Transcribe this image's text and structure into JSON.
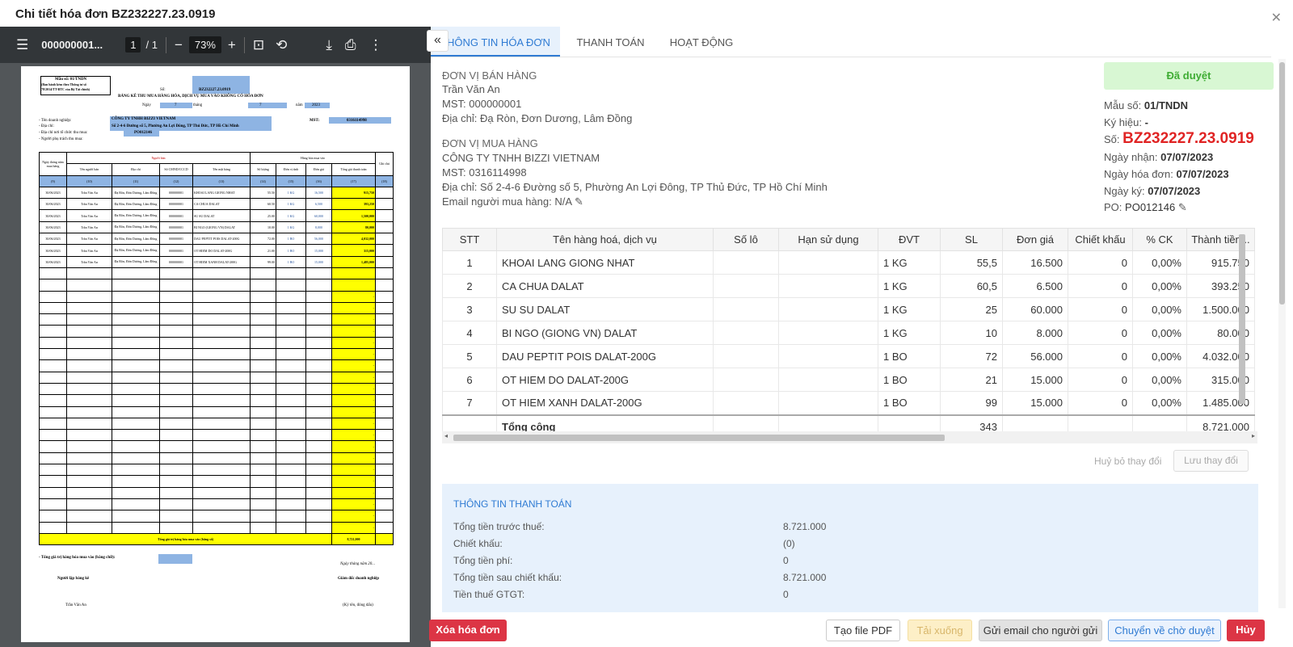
{
  "modal": {
    "title": "Chi tiết hóa đơn BZ232227.23.0919"
  },
  "pdf": {
    "filename": "000000001...",
    "page_current": "1",
    "page_total": "/ 1",
    "zoom": "73%",
    "sheet": {
      "mau_so": "Mẫu số: 01/TNDN",
      "note1": "(Ban hành kèm theo Thông tư số",
      "note2": "78/2014/TT-BTC của Bộ Tài chính)",
      "so_label": "Số:",
      "so": "BZ232227.23.0919",
      "title": "BẢNG KÊ THU MUA HÀNG HÓA, DỊCH VỤ MUA VÀO KHÔNG CÓ HÓA ĐƠN",
      "ngay_label": "Ngày",
      "ngay": "7",
      "thang_label": "tháng",
      "thang": "7",
      "nam_label": "năm",
      "nam": "2023",
      "dn_label": "- Tên doanh nghiệp:",
      "dn": "CÔNG TY TNHH BIZZI VIETNAM",
      "mst_label": "MST:",
      "mst": "0316114998",
      "dc_label": "- Địa chỉ:",
      "dc": "Số 2-4-6 Đường số 5, Phường An Lợi Đông, TP Thủ Đức, TP Hồ Chí Minh",
      "noi_label": "- Địa chỉ nơi tổ chức thu mua:",
      "po": "PO012146",
      "nguoi_label": "- Người phụ trách thu mua:",
      "h_nguoiban": "Người bán",
      "h_hanghoa": "Hàng hóa mua vào",
      "cols": [
        "Ngày tháng năm mua hàng",
        "Tên người bán",
        "Địa chỉ",
        "Số CMND/CCCD",
        "Tên mặt hàng",
        "Số lượng",
        "Đơn vị tính",
        "Đơn giá",
        "Tổng giá thanh toán",
        "Ghi chú"
      ],
      "colnums": [
        "(9)",
        "(10)",
        "(11)",
        "(12)",
        "(13)",
        "(14)",
        "(15)",
        "(16)",
        "(17)",
        "(18)"
      ],
      "rows": [
        [
          "30/06/2023",
          "Trần Văn An",
          "Đạ Rồn, Đơn Dương, Lâm Đồng",
          "000000001",
          "KHOAI LANG GIONG NHAT",
          "55.50",
          "1 KG",
          "16,500",
          "915,750"
        ],
        [
          "30/06/2023",
          "Trần Văn An",
          "Đạ Rồn, Đơn Dương, Lâm Đồng",
          "000000001",
          "CA CHUA DALAT",
          "60.50",
          "1 KG",
          "6,500",
          "393,250"
        ],
        [
          "30/06/2023",
          "Trần Văn An",
          "Đạ Rồn, Đơn Dương, Lâm Đồng",
          "000000001",
          "SU SU DALAT",
          "25.00",
          "1 KG",
          "60,000",
          "1,500,000"
        ],
        [
          "30/06/2023",
          "Trần Văn An",
          "Đạ Rồn, Đơn Dương, Lâm Đồng",
          "000000001",
          "BI NGO (GIONG VN) DALAT",
          "10.00",
          "1 KG",
          "8,000",
          "80,000"
        ],
        [
          "30/06/2023",
          "Trần Văn An",
          "Đạ Rồn, Đơn Dương, Lâm Đồng",
          "000000001",
          "DAU PEPTIT POIS DALAT-200G",
          "72.00",
          "1 BO",
          "56,000",
          "4,032,000"
        ],
        [
          "30/06/2023",
          "Trần Văn An",
          "Đạ Rồn, Đơn Dương, Lâm Đồng",
          "000000001",
          "OT HIEM DO DALAT-200G",
          "21.00",
          "1 BO",
          "15,000",
          "315,000"
        ],
        [
          "30/06/2023",
          "Trần Văn An",
          "Đạ Rồn, Đơn Dương, Lâm Đồng",
          "000000001",
          "OT HIEM XANH DALAT-200G",
          "99.00",
          "1 BO",
          "15,000",
          "1,485,000"
        ]
      ],
      "dash": "-",
      "total_label": "Tổng giá trị hàng hóa mua vào (bằng số)",
      "total": "8,721,000",
      "total_text_label": "- Tổng giá trị hàng hóa mua vào (bằng chữ):",
      "date_line": "Ngày tháng năm 20...",
      "nguoi_lap": "Người lập bảng kê",
      "giam_doc": "Giám đốc doanh nghiệp",
      "signer": "Trần Văn An",
      "ky_ten": "(Ký tên, đóng dấu)"
    }
  },
  "tabs": [
    "THÔNG TIN HÓA ĐƠN",
    "THANH TOÁN",
    "HOẠT ĐỘNG"
  ],
  "seller": {
    "heading": "ĐƠN VỊ BÁN HÀNG",
    "name": "Trần Văn An",
    "mst_label": "MST:",
    "mst": "000000001",
    "addr_label": "Địa chỉ:",
    "addr": "Đạ Ròn, Đơn Dương, Lâm Đồng"
  },
  "buyer": {
    "heading": "ĐƠN VỊ MUA HÀNG",
    "name": "CÔNG TY TNHH BIZZI VIETNAM",
    "mst_label": "MST:",
    "mst": "0316114998",
    "addr_label": "Địa chỉ:",
    "addr": "Số 2-4-6 Đường số 5, Phường An Lợi Đông, TP Thủ Đức, TP Hồ Chí Minh",
    "email_label": "Email người mua hàng:",
    "email": "N/A"
  },
  "status": "Đã duyệt",
  "meta": {
    "mau_so_label": "Mẫu số:",
    "mau_so": "01/TNDN",
    "ky_hieu_label": "Ký hiệu:",
    "ky_hieu": "-",
    "so_label": "Số:",
    "so": "BZ232227.23.0919",
    "ngay_nhan_label": "Ngày nhận:",
    "ngay_nhan": "07/07/2023",
    "ngay_hd_label": "Ngày hóa đơn:",
    "ngay_hd": "07/07/2023",
    "ngay_ky_label": "Ngày ký:",
    "ngay_ky": "07/07/2023",
    "po_label": "PO:",
    "po": "PO012146"
  },
  "items": {
    "headers": [
      "STT",
      "Tên hàng hoá, dịch vụ",
      "Số lô",
      "Hạn sử dụng",
      "ĐVT",
      "SL",
      "Đơn giá",
      "Chiết khấu",
      "% CK",
      "Thành tiền..."
    ],
    "rows": [
      [
        "1",
        "KHOAI LANG GIONG NHAT",
        "",
        "",
        "1 KG",
        "55,5",
        "16.500",
        "0",
        "0,00%",
        "915.750"
      ],
      [
        "2",
        "CA CHUA DALAT",
        "",
        "",
        "1 KG",
        "60,5",
        "6.500",
        "0",
        "0,00%",
        "393.250"
      ],
      [
        "3",
        "SU SU DALAT",
        "",
        "",
        "1 KG",
        "25",
        "60.000",
        "0",
        "0,00%",
        "1.500.000"
      ],
      [
        "4",
        "BI NGO (GIONG VN) DALAT",
        "",
        "",
        "1 KG",
        "10",
        "8.000",
        "0",
        "0,00%",
        "80.000"
      ],
      [
        "5",
        "DAU PEPTIT POIS DALAT-200G",
        "",
        "",
        "1 BO",
        "72",
        "56.000",
        "0",
        "0,00%",
        "4.032.000"
      ],
      [
        "6",
        "OT HIEM DO DALAT-200G",
        "",
        "",
        "1 BO",
        "21",
        "15.000",
        "0",
        "0,00%",
        "315.000"
      ],
      [
        "7",
        "OT HIEM XANH DALAT-200G",
        "",
        "",
        "1 BO",
        "99",
        "15.000",
        "0",
        "0,00%",
        "1.485.000"
      ]
    ],
    "total_label": "Tổng cộng",
    "total_qty": "343",
    "total_amount": "8.721.000",
    "trunc": "K"
  },
  "actions": {
    "undo": "Huỷ bỏ thay đổi",
    "save": "Lưu thay đổi"
  },
  "payment": {
    "title": "THÔNG TIN THANH TOÁN",
    "rows": [
      {
        "k": "Tổng tiền trước thuế:",
        "v": "8.721.000"
      },
      {
        "k": "Chiết khấu:",
        "v": "(0)"
      },
      {
        "k": "Tổng tiền phí:",
        "v": "0"
      },
      {
        "k": "Tổng tiền sau chiết khấu:",
        "v": "8.721.000"
      },
      {
        "k": "Tiền thuế GTGT:",
        "v": "0"
      }
    ]
  },
  "footer": {
    "delete": "Xóa hóa đơn",
    "pdf": "Tạo file PDF",
    "download": "Tải xuống",
    "email": "Gửi email cho người gửi",
    "pending": "Chuyển về chờ duyệt",
    "cancel": "Hủy"
  },
  "colors": {
    "primary": "#2f7bd3",
    "danger": "#dc3545",
    "approved_bg": "#d8f7d3",
    "approved_text": "#3eac33",
    "invoice_no": "#e02424"
  }
}
